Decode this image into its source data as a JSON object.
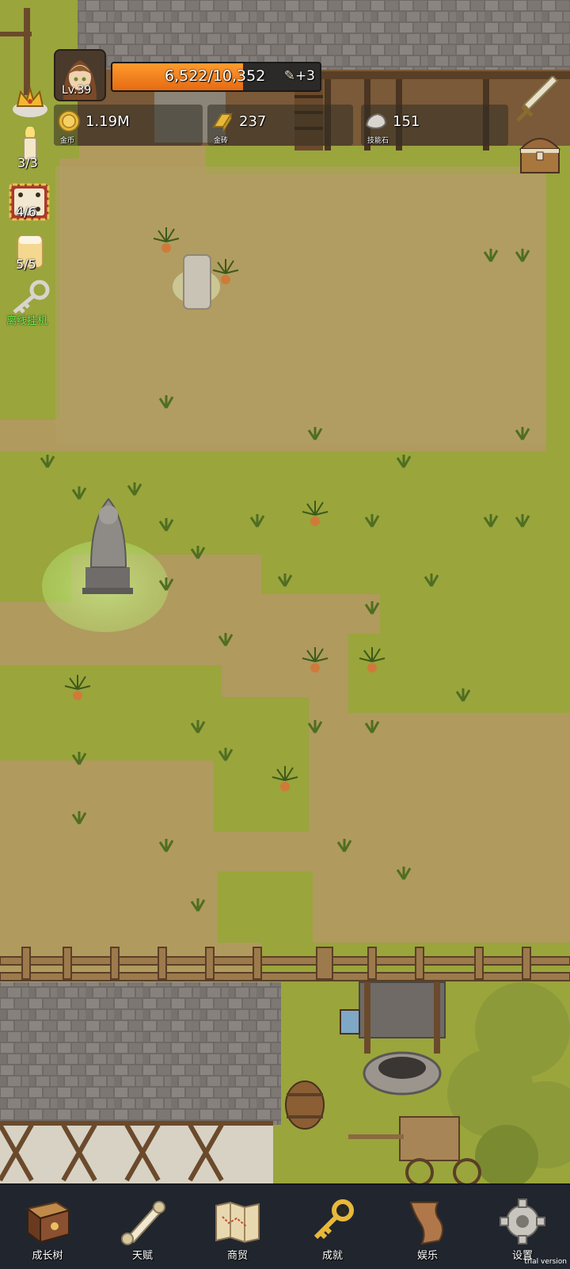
{
  "player": {
    "level": "Lv.39",
    "xp_text": "6,522/10,352",
    "xp_fraction": 0.63,
    "xp_bonus": "+3"
  },
  "resources": [
    {
      "name": "coin",
      "value": "1.19M",
      "label": "金币",
      "icon": "gold-coin-icon"
    },
    {
      "name": "gold-brick",
      "value": "237",
      "label": "金砖",
      "icon": "gold-brick-icon"
    },
    {
      "name": "skill-stone",
      "value": "151",
      "label": "技能石",
      "icon": "skill-stone-icon"
    }
  ],
  "side_items": {
    "candle": "3/3",
    "dice": "4/6",
    "beer": "5/5",
    "idle_label": "离线挂机"
  },
  "nav": [
    {
      "label": "成长树",
      "icon": "book-icon"
    },
    {
      "label": "天赋",
      "icon": "scroll-icon"
    },
    {
      "label": "商贸",
      "icon": "map-icon"
    },
    {
      "label": "成就",
      "icon": "key-icon"
    },
    {
      "label": "娱乐",
      "icon": "banner-icon"
    },
    {
      "label": "设置",
      "icon": "gear-icon"
    }
  ],
  "watermark": "trial version",
  "colors": {
    "grass": "#9aa53c",
    "dirt": "#b09a5e",
    "xp_bar": "#f08a24",
    "nav_bg": "#21262e"
  }
}
